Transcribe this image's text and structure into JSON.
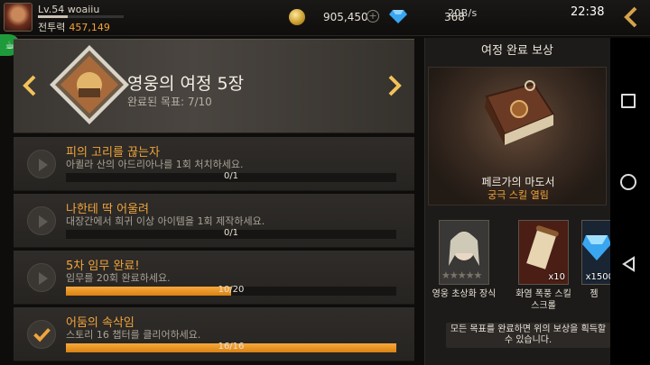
{
  "player": {
    "level_name": "Lv.54 woaiiu",
    "power_label": "전투력",
    "power_value": "457,149"
  },
  "currency": {
    "gold": "905,450",
    "gem": "368"
  },
  "status_bar": {
    "net_speed": "20B/s",
    "time": "22:38"
  },
  "chapter": {
    "title": "영웅의 여정 5장",
    "progress": "완료된 목표: 7/10"
  },
  "quests": [
    {
      "title": "피의 고리를 끊는자",
      "desc": "아퀼라 산의 아드리아나를 1회 처치하세요.",
      "count": "0/1",
      "fraction": 0,
      "done": false
    },
    {
      "title": "나한테 딱 어울려",
      "desc": "대장간에서 희귀 이상 아이템을 1회 제작하세요.",
      "count": "0/1",
      "fraction": 0,
      "done": false
    },
    {
      "title": "5차 임무 완료!",
      "desc": "임무를 20회 완료하세요.",
      "count": "10/20",
      "fraction": 0.5,
      "done": false
    },
    {
      "title": "어둠의 속삭임",
      "desc": "스토리 16 챕터를 클리어하세요.",
      "count": "16/16",
      "fraction": 1,
      "done": true
    }
  ],
  "reward": {
    "header": "여정 완료 보상",
    "main_name": "페르가의 마도서",
    "main_sub": "궁극 스킬 열림",
    "items": [
      {
        "label": "영웅 초상화 장식",
        "qty": ""
      },
      {
        "label": "화염 폭풍 스킬 스크롤",
        "qty": "x10"
      },
      {
        "label": "젬",
        "qty": "x1500"
      }
    ],
    "notice": "모든 목표를 완료하면 위의 보상을 획득할 수 있습니다."
  },
  "colors": {
    "accent": "#f0a43c",
    "bar_fill": "#e8921f",
    "panel": "#2f2c29"
  },
  "icons": [
    "gold-coin-icon",
    "gem-icon",
    "arrow-left-icon",
    "arrow-right-icon",
    "play-icon",
    "check-icon",
    "back-icon"
  ]
}
